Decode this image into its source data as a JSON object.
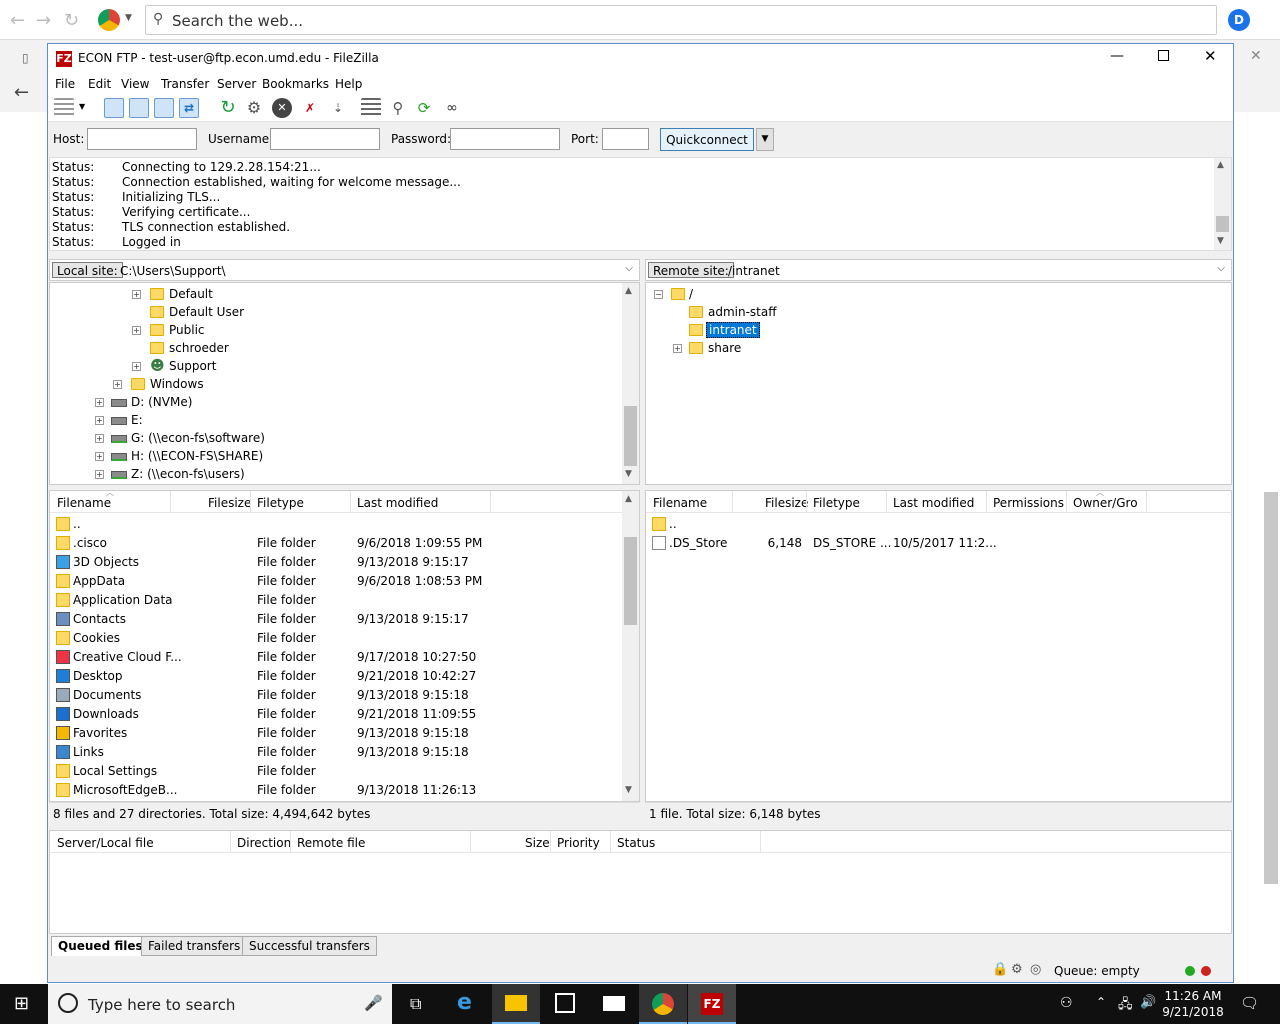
{
  "browser": {
    "omnibox_placeholder": "Search the web...",
    "profile_initial": "D"
  },
  "window": {
    "title": "ECON FTP - test-user@ftp.econ.umd.edu - FileZilla",
    "logo": "FZ"
  },
  "menu": [
    "File",
    "Edit",
    "View",
    "Transfer",
    "Server",
    "Bookmarks",
    "Help"
  ],
  "quickconnect": {
    "host_label": "Host:",
    "username_label": "Username:",
    "password_label": "Password:",
    "port_label": "Port:",
    "host": "",
    "username": "",
    "password": "",
    "port": "",
    "button": "Quickconnect"
  },
  "log": [
    {
      "k": "Status:",
      "v": "Connecting to 129.2.28.154:21..."
    },
    {
      "k": "Status:",
      "v": "Connection established, waiting for welcome message..."
    },
    {
      "k": "Status:",
      "v": "Initializing TLS..."
    },
    {
      "k": "Status:",
      "v": "Verifying certificate..."
    },
    {
      "k": "Status:",
      "v": "TLS connection established."
    },
    {
      "k": "Status:",
      "v": "Logged in"
    }
  ],
  "local": {
    "site_label": "Local site:",
    "path": "C:\\Users\\Support\\",
    "tree": [
      "Default",
      "Default User",
      "Public",
      "schroeder",
      "Support",
      "Windows",
      "D: (NVMe)",
      "E:",
      "G: (\\\\econ-fs\\software)",
      "H: (\\\\ECON-FS\\SHARE)",
      "Z: (\\\\econ-fs\\users)"
    ],
    "columns": [
      "Filename",
      "Filesize",
      "Filetype",
      "Last modified"
    ],
    "files": [
      {
        "name": "..",
        "size": "",
        "type": "",
        "modified": ""
      },
      {
        "name": ".cisco",
        "size": "",
        "type": "File folder",
        "modified": "9/6/2018 1:09:55 PM"
      },
      {
        "name": "3D Objects",
        "size": "",
        "type": "File folder",
        "modified": "9/13/2018 9:15:17"
      },
      {
        "name": "AppData",
        "size": "",
        "type": "File folder",
        "modified": "9/6/2018 1:08:53 PM"
      },
      {
        "name": "Application Data",
        "size": "",
        "type": "File folder",
        "modified": ""
      },
      {
        "name": "Contacts",
        "size": "",
        "type": "File folder",
        "modified": "9/13/2018 9:15:17"
      },
      {
        "name": "Cookies",
        "size": "",
        "type": "File folder",
        "modified": ""
      },
      {
        "name": "Creative Cloud F...",
        "size": "",
        "type": "File folder",
        "modified": "9/17/2018 10:27:50"
      },
      {
        "name": "Desktop",
        "size": "",
        "type": "File folder",
        "modified": "9/21/2018 10:42:27"
      },
      {
        "name": "Documents",
        "size": "",
        "type": "File folder",
        "modified": "9/13/2018 9:15:18"
      },
      {
        "name": "Downloads",
        "size": "",
        "type": "File folder",
        "modified": "9/21/2018 11:09:55"
      },
      {
        "name": "Favorites",
        "size": "",
        "type": "File folder",
        "modified": "9/13/2018 9:15:18"
      },
      {
        "name": "Links",
        "size": "",
        "type": "File folder",
        "modified": "9/13/2018 9:15:18"
      },
      {
        "name": "Local Settings",
        "size": "",
        "type": "File folder",
        "modified": ""
      },
      {
        "name": "MicrosoftEdgeB...",
        "size": "",
        "type": "File folder",
        "modified": "9/13/2018 11:26:13"
      }
    ],
    "status": "8 files and 27 directories. Total size: 4,494,642 bytes"
  },
  "remote": {
    "site_label": "Remote site:",
    "path": "/intranet",
    "tree": [
      "/",
      "admin-staff",
      "intranet",
      "share"
    ],
    "columns": [
      "Filename",
      "Filesize",
      "Filetype",
      "Last modified",
      "Permissions",
      "Owner/Gro"
    ],
    "files": [
      {
        "name": "..",
        "size": "",
        "type": "",
        "modified": ""
      },
      {
        "name": ".DS_Store",
        "size": "6,148",
        "type": "DS_STORE ...",
        "modified": "10/5/2017 11:2..."
      }
    ],
    "status": "1 file. Total size: 6,148 bytes"
  },
  "queue": {
    "columns": [
      "Server/Local file",
      "Direction",
      "Remote file",
      "Size",
      "Priority",
      "Status"
    ],
    "tabs": [
      "Queued files",
      "Failed transfers",
      "Successful transfers"
    ],
    "status": "Queue: empty"
  },
  "taskbar": {
    "search_placeholder": "Type here to search",
    "time": "11:26 AM",
    "date": "9/21/2018"
  }
}
